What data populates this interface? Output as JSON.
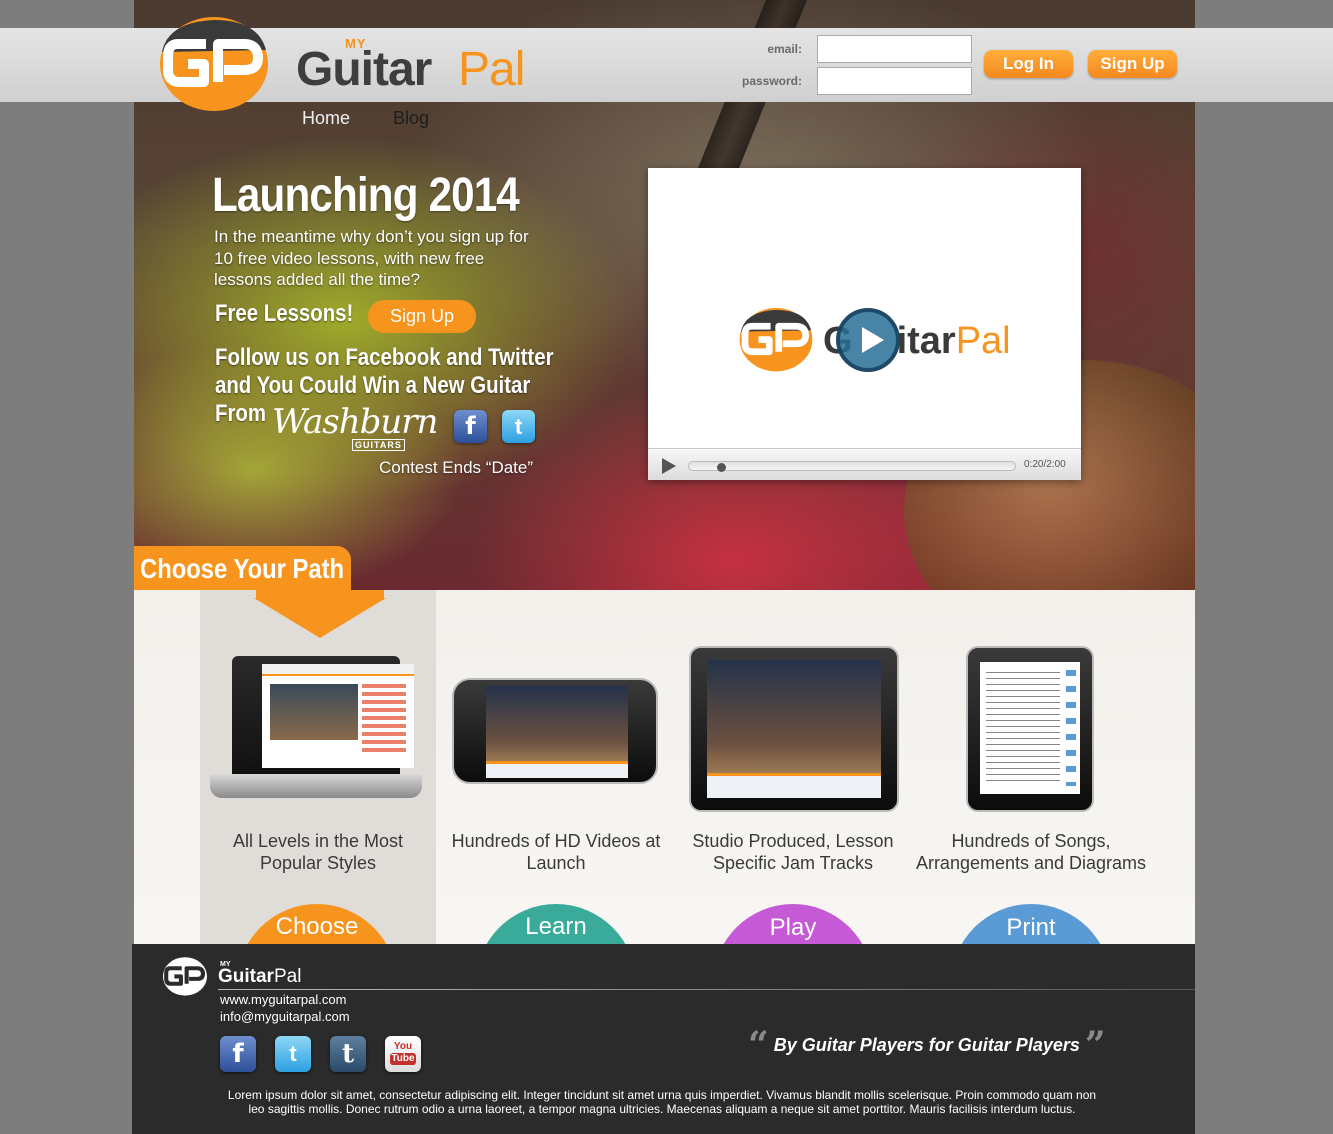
{
  "brand": {
    "logo_my": "MY",
    "logo_guitar": "Guitar",
    "logo_pal": "Pal",
    "colors": {
      "orange": "#f7941d",
      "dark": "#3e3e3e"
    }
  },
  "login": {
    "email_label": "email:",
    "password_label": "password:",
    "email_value": "",
    "password_value": "",
    "login_button": "Log In",
    "signup_button": "Sign Up"
  },
  "nav": {
    "items": [
      {
        "label": "Home",
        "active": true
      },
      {
        "label": "Blog",
        "active": false
      }
    ]
  },
  "hero": {
    "title": "Launching 2014",
    "description": "In the meantime why don’t you sign up for 10 free video lessons, with new free lessons added all the time?",
    "free_lessons": "Free Lessons!",
    "signup_button": "Sign Up",
    "follow_text": "Follow us on Facebook and Twitter and You Could Win a New Guitar From",
    "washburn": "Washburn",
    "washburn_sub": "GUITARS",
    "contest": "Contest Ends “Date”",
    "social": [
      {
        "icon": "facebook-icon",
        "glyph": "f"
      },
      {
        "icon": "twitter-icon",
        "glyph": "t"
      }
    ]
  },
  "video": {
    "logo_text_a": "G",
    "logo_text_b": "itar",
    "logo_pal": "Pal",
    "time": "0:20/2:00",
    "progress": 0.1
  },
  "path": {
    "title": "Choose Your Path",
    "items": [
      {
        "caption": "All Levels in the Most Popular Styles",
        "button": "Choose",
        "color": "#f7941d"
      },
      {
        "caption": "Hundreds of HD Videos at Launch",
        "button": "Learn",
        "color": "#3aaa9a"
      },
      {
        "caption": "Studio Produced, Lesson Specific Jam Tracks",
        "button": "Play",
        "color": "#c659d6"
      },
      {
        "caption": "Hundreds of Songs, Arrangements and Diagrams",
        "button": "Print",
        "color": "#5a9ad5"
      }
    ]
  },
  "footer": {
    "logo_my": "MY",
    "logo_guitar": "Guitar",
    "logo_pal": "Pal",
    "website": "www.myguitarpal.com",
    "email": "info@myguitarpal.com",
    "social": [
      {
        "icon": "facebook-icon",
        "glyph": "f"
      },
      {
        "icon": "twitter-icon",
        "glyph": "t"
      },
      {
        "icon": "tumblr-icon",
        "glyph": "t"
      },
      {
        "icon": "youtube-icon",
        "glyph_a": "You",
        "glyph_b": "Tube"
      }
    ],
    "tagline": "By Guitar Players for Guitar Players",
    "lorem": "Lorem ipsum dolor sit amet, consectetur adipiscing elit. Integer tincidunt sit amet urna quis imperdiet. Vivamus blandit mollis scelerisque. Proin commodo quam non leo sagittis mollis. Donec rutrum odio a urna laoreet, a tempor magna ultricies. Maecenas aliquam a neque sit amet porttitor. Mauris facilisis interdum luctus."
  }
}
